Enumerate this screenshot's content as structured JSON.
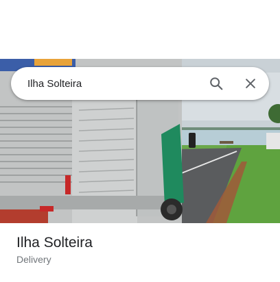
{
  "search": {
    "query": "Ilha Solteira",
    "search_icon": "search-icon",
    "close_icon": "close-icon"
  },
  "photo": {
    "description_icon": "place-photo"
  },
  "place": {
    "title": "Ilha Solteira",
    "category": "Delivery"
  },
  "colors": {
    "truck_cab": "#1f8a5e",
    "grass": "#5fa33f",
    "lake": "#b7cdd6"
  }
}
